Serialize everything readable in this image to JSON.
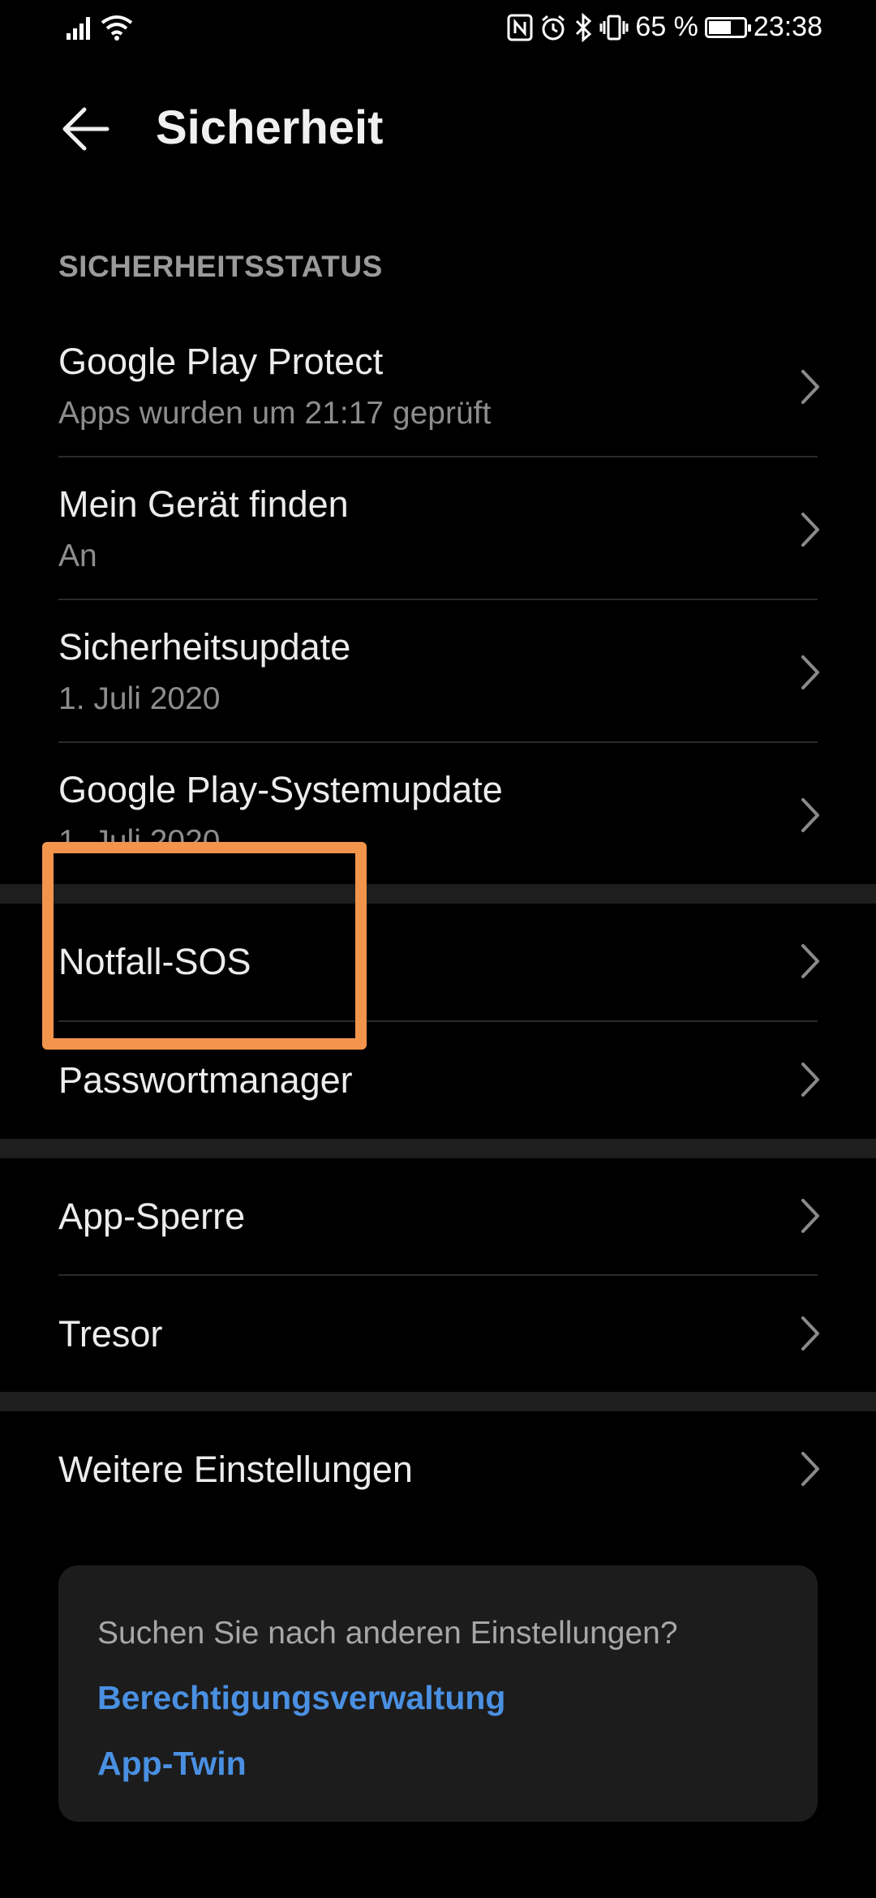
{
  "status_bar": {
    "battery_text": "65 %",
    "battery_level": 0.65,
    "time": "23:38",
    "icons": [
      "signal-icon",
      "wifi-icon",
      "nfc-icon",
      "alarm-icon",
      "bluetooth-icon",
      "vibrate-icon",
      "battery-icon"
    ]
  },
  "header": {
    "title": "Sicherheit",
    "back_icon": "back-arrow-icon"
  },
  "security_status": {
    "section_title": "SICHERHEITSSTATUS",
    "items": [
      {
        "title": "Google Play Protect",
        "subtitle": "Apps wurden um 21:17 geprüft"
      },
      {
        "title": "Mein Gerät finden",
        "subtitle": "An"
      },
      {
        "title": "Sicherheitsupdate",
        "subtitle": "1. Juli 2020"
      },
      {
        "title": "Google Play-Systemupdate",
        "subtitle": "1. Juli 2020"
      }
    ]
  },
  "group2": {
    "items": [
      {
        "title": "Notfall-SOS"
      },
      {
        "title": "Passwortmanager"
      }
    ]
  },
  "group3": {
    "items": [
      {
        "title": "App-Sperre"
      },
      {
        "title": "Tresor"
      }
    ]
  },
  "group4": {
    "items": [
      {
        "title": "Weitere Einstellungen"
      }
    ]
  },
  "suggestions": {
    "question": "Suchen Sie nach anderen Einstellungen?",
    "links": [
      "Berechtigungsverwaltung",
      "App-Twin"
    ]
  },
  "colors": {
    "background": "#000000",
    "highlight": "#f2944c",
    "link": "#4a90e2",
    "card": "#1c1c1c"
  }
}
